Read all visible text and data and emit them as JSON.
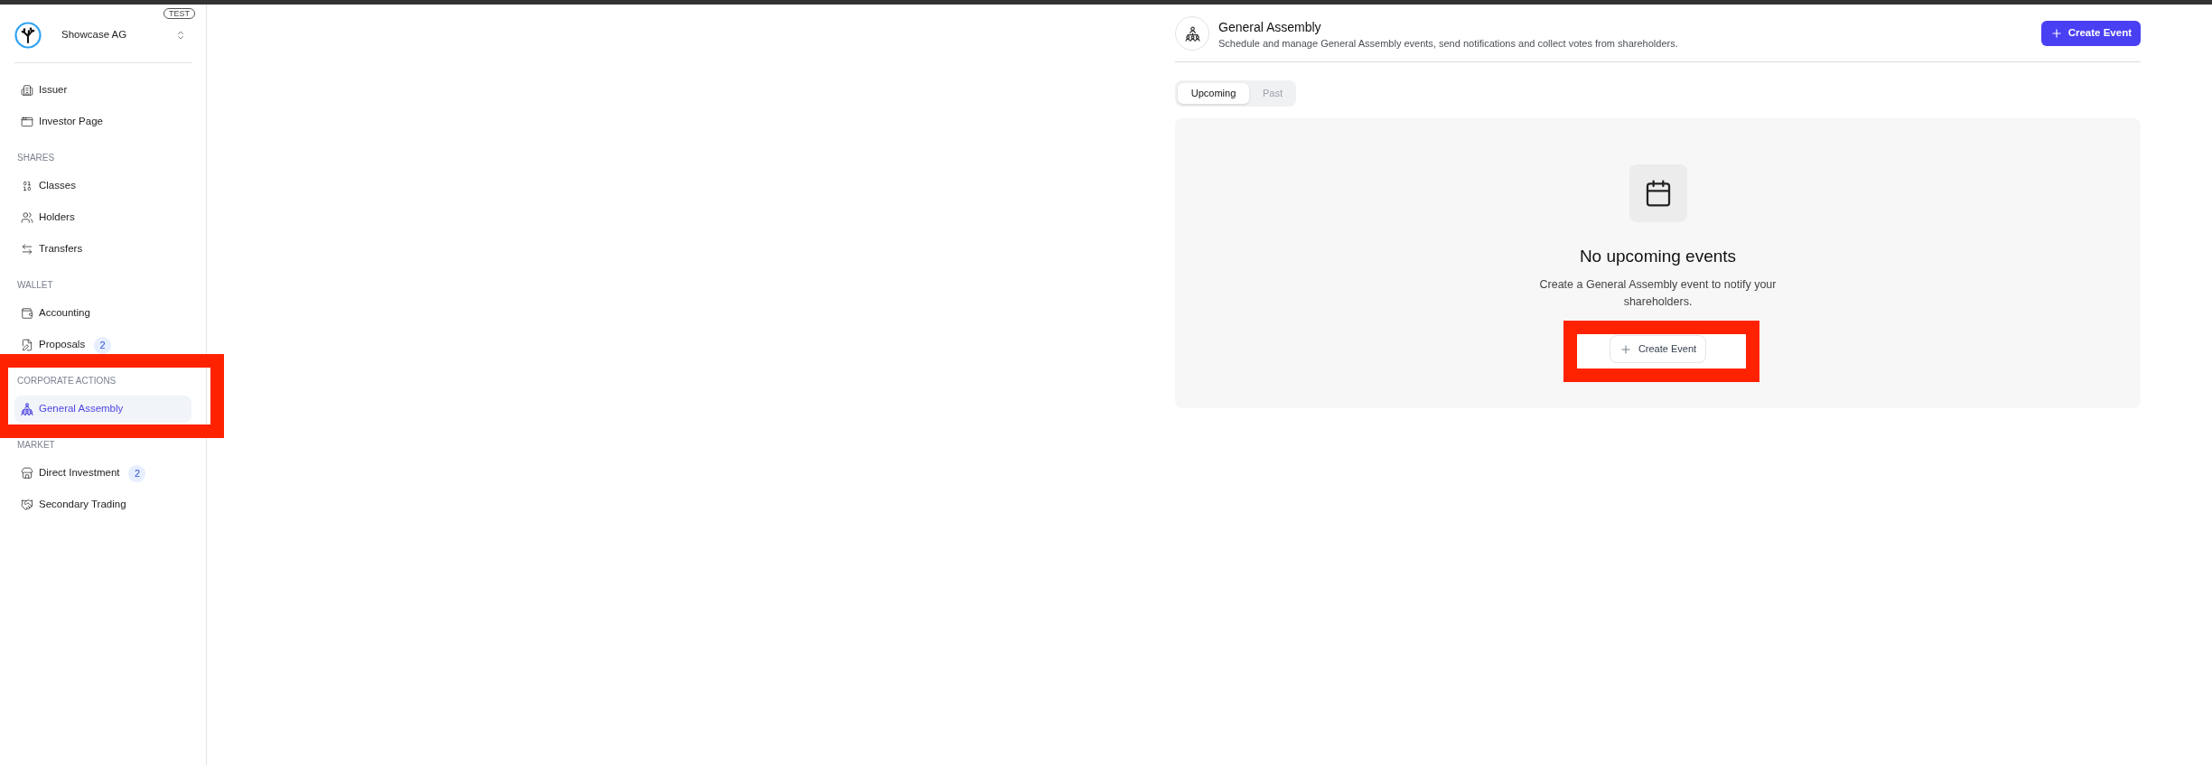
{
  "organization": {
    "name": "Showcase AG",
    "badge": "TEST"
  },
  "sidebar": {
    "groups": [
      {
        "highlighted": false,
        "items": [
          {
            "label": "Issuer",
            "selected": false
          },
          {
            "label": "Investor Page",
            "selected": false
          }
        ]
      },
      {
        "heading": "SHARES",
        "highlighted": false,
        "items": [
          {
            "label": "Classes",
            "selected": false
          },
          {
            "label": "Holders",
            "selected": false
          },
          {
            "label": "Transfers",
            "selected": false
          }
        ]
      },
      {
        "heading": "WALLET",
        "highlighted": false,
        "items": [
          {
            "label": "Accounting",
            "selected": false
          },
          {
            "label": "Proposals",
            "badge": "2",
            "selected": false
          }
        ]
      },
      {
        "heading": "CORPORATE ACTIONS",
        "highlighted": true,
        "items": [
          {
            "label": "General Assembly",
            "selected": true
          }
        ]
      },
      {
        "heading": "MARKET",
        "highlighted": false,
        "items": [
          {
            "label": "Direct Investment",
            "badge": "2",
            "selected": false
          },
          {
            "label": "Secondary Trading",
            "selected": false
          }
        ]
      }
    ]
  },
  "main": {
    "header": {
      "title": "General Assembly",
      "subtitle": "Schedule and manage General Assembly events, send notifications and collect votes from shareholders.",
      "action": "Create Event"
    },
    "tabs": [
      {
        "label": "Upcoming",
        "selected": true
      },
      {
        "label": "Past",
        "selected": false
      }
    ],
    "empty_state": {
      "title": "No upcoming events",
      "description": "Create a General Assembly event to notify your shareholders.",
      "button": {
        "label": "Create Event",
        "highlighted": true
      }
    }
  }
}
